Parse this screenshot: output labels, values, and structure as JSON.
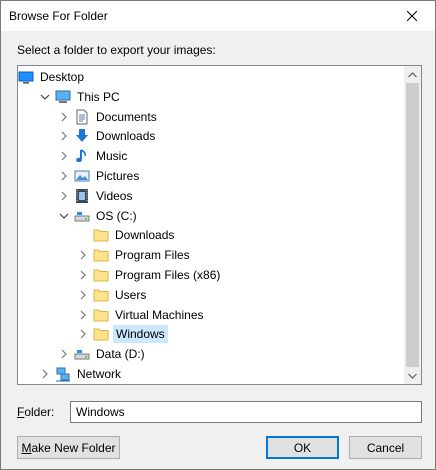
{
  "window": {
    "title": "Browse For Folder"
  },
  "prompt": "Select a folder to export your images:",
  "tree": [
    {
      "label": "Desktop",
      "icon": "desktop-icon",
      "indent": 0,
      "expander": "none"
    },
    {
      "label": "This PC",
      "icon": "computer-icon",
      "indent": 1,
      "expander": "expanded"
    },
    {
      "label": "Documents",
      "icon": "documents-icon",
      "indent": 2,
      "expander": "collapsed"
    },
    {
      "label": "Downloads",
      "icon": "downloads-icon",
      "indent": 2,
      "expander": "collapsed"
    },
    {
      "label": "Music",
      "icon": "music-icon",
      "indent": 2,
      "expander": "collapsed"
    },
    {
      "label": "Pictures",
      "icon": "pictures-icon",
      "indent": 2,
      "expander": "collapsed"
    },
    {
      "label": "Videos",
      "icon": "videos-icon",
      "indent": 2,
      "expander": "collapsed"
    },
    {
      "label": "OS (C:)",
      "icon": "drive-icon",
      "indent": 2,
      "expander": "expanded"
    },
    {
      "label": "Downloads",
      "icon": "folder-icon",
      "indent": 3,
      "expander": "none"
    },
    {
      "label": "Program Files",
      "icon": "folder-icon",
      "indent": 3,
      "expander": "collapsed"
    },
    {
      "label": "Program Files (x86)",
      "icon": "folder-icon",
      "indent": 3,
      "expander": "collapsed"
    },
    {
      "label": "Users",
      "icon": "folder-icon",
      "indent": 3,
      "expander": "collapsed"
    },
    {
      "label": "Virtual Machines",
      "icon": "folder-icon",
      "indent": 3,
      "expander": "collapsed"
    },
    {
      "label": "Windows",
      "icon": "folder-icon",
      "indent": 3,
      "expander": "collapsed",
      "selected": true
    },
    {
      "label": "Data (D:)",
      "icon": "drive-icon",
      "indent": 2,
      "expander": "collapsed"
    },
    {
      "label": "Network",
      "icon": "network-icon",
      "indent": 1,
      "expander": "collapsed"
    }
  ],
  "folder_field": {
    "label": "Folder:",
    "value": "Windows"
  },
  "buttons": {
    "make_new_folder": "Make New Folder",
    "ok": "OK",
    "cancel": "Cancel"
  },
  "colors": {
    "selection": "#cce8ff",
    "accent": "#0078d7",
    "folder": "#ffe38c"
  }
}
